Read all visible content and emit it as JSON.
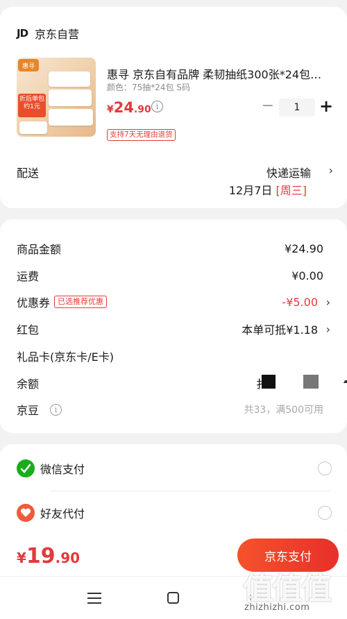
{
  "shop": {
    "logo": "JD",
    "name": "京东自营"
  },
  "product": {
    "image": {
      "badge": "惠寻",
      "promo": "折后单包约1元"
    },
    "title": "惠寻 京东自有品牌 柔韧抽纸300张*24包…",
    "spec": "颜色：75抽*24包 S码",
    "price": {
      "currency": "¥",
      "integer": "24",
      "decimal": ".90"
    },
    "info_icon": "ⓘ",
    "quantity": "1",
    "minus": "−",
    "plus": "+",
    "return_policy": "支持7天无理由退货"
  },
  "shipping": {
    "label": "配送",
    "method": "快递运输",
    "date": "12月7日",
    "weekday": "[周三]",
    "chevron": "›"
  },
  "fees": [
    {
      "label": "商品金额",
      "value": "¥24.90"
    },
    {
      "label": "运费",
      "value": "¥0.00"
    },
    {
      "label": "优惠券",
      "tag": "已选推荐优惠",
      "value": "-¥5.00"
    },
    {
      "label": "红包",
      "value": "本单可抵¥1.18"
    },
    {
      "label": "礼品卡(京东卡/E卡)"
    },
    {
      "label": "余额",
      "partial_text": "扌"
    },
    {
      "label": "京豆",
      "value": "共33，满500可用"
    }
  ],
  "payment": {
    "methods": [
      {
        "name": "微信支付",
        "icon": "wechat-icon",
        "selected": false
      },
      {
        "name": "好友代付",
        "icon": "heart-gift-icon",
        "selected": false
      }
    ]
  },
  "bottom": {
    "total": {
      "currency": "¥",
      "integer": "19",
      "decimal": ".90"
    },
    "pay_button": "京东支付"
  },
  "watermark": {
    "logo": "值值值",
    "url": "zhizhizhi.com"
  },
  "colors": {
    "accent": "#e4393c",
    "wechat": "#1aad19",
    "button": "#f5522b"
  }
}
